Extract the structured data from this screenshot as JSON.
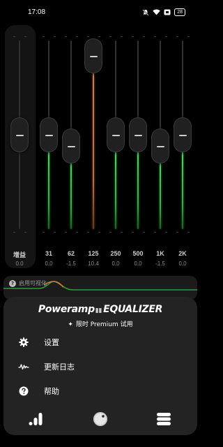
{
  "status_bar": {
    "time": "17:08",
    "battery": "28",
    "icons": [
      "mute-bell-icon",
      "wifi-icon",
      "card-icon",
      "battery-icon"
    ]
  },
  "equalizer": {
    "preamp": {
      "label": "增益",
      "value": "0.0",
      "level": 0.5
    },
    "bands": [
      {
        "label": "31",
        "value": "0.0",
        "level": 0.5,
        "color": "#3be34a"
      },
      {
        "label": "62",
        "value": "-1.5",
        "level": 0.44,
        "color": "#3be34a"
      },
      {
        "label": "125",
        "value": "10.4",
        "level": 0.92,
        "color": "#d8803c"
      },
      {
        "label": "250",
        "value": "0.0",
        "level": 0.5,
        "color": "#3be34a"
      },
      {
        "label": "500",
        "value": "0.0",
        "level": 0.5,
        "color": "#3be34a"
      },
      {
        "label": "1K",
        "value": "-1.5",
        "level": 0.44,
        "color": "#3be34a"
      },
      {
        "label": "2K",
        "value": "0.0",
        "level": 0.5,
        "color": "#3be34a"
      }
    ]
  },
  "curve_panel": {
    "badge": "?",
    "label": "启用可视化"
  },
  "menu": {
    "logo_left": "Poweramp",
    "logo_right": "EQUALIZER",
    "premium": "限时 Premium 试用",
    "items": [
      {
        "label": "设置",
        "icon": "gear-icon"
      },
      {
        "label": "更新日志",
        "icon": "changelog-wave-icon"
      },
      {
        "label": "帮助",
        "icon": "help-icon"
      }
    ],
    "nav": [
      "equalizer-bars-icon",
      "knob-icon",
      "menu-stack-icon"
    ]
  },
  "colors": {
    "accent_green": "#3be34a",
    "accent_orange": "#d8803c",
    "sheet_bg": "#232323"
  }
}
